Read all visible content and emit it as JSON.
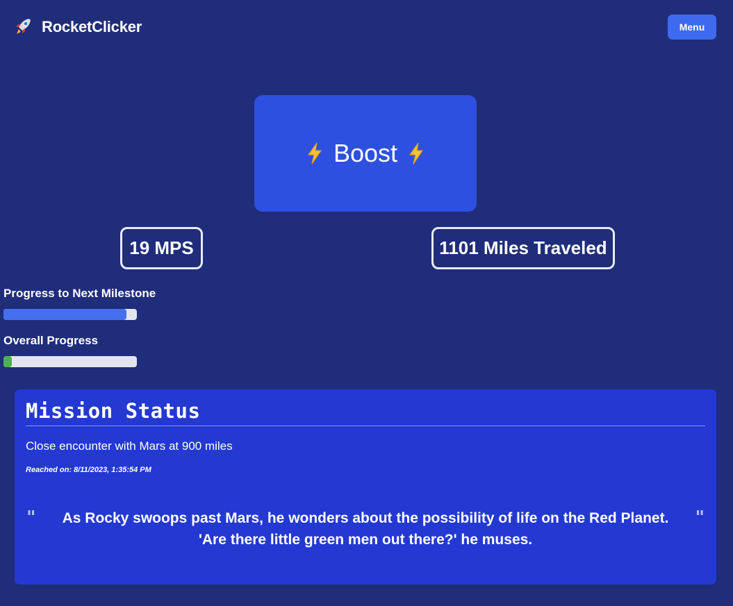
{
  "header": {
    "title": "RocketClicker",
    "logo_icon": "rocket-icon",
    "menu_label": "Menu"
  },
  "boost": {
    "label": "Boost",
    "icon": "lightning-bolt-icon"
  },
  "stats": {
    "mps": "19 MPS",
    "miles": "1101 Miles Traveled"
  },
  "progress": {
    "next_milestone": {
      "label": "Progress to Next Milestone",
      "percent": 92,
      "color": "#4470ee"
    },
    "overall": {
      "label": "Overall Progress",
      "percent": 6,
      "color": "#4cb050"
    }
  },
  "mission": {
    "title": "Mission Status",
    "event": "Close encounter with Mars at 900 miles",
    "reached_on": "Reached on: 8/11/2023, 1:35:54 PM",
    "quote_open": "\"",
    "quote_close": "\"",
    "quote": "As Rocky swoops past Mars, he wonders about the possibility of life on the Red Planet. 'Are there little green men out there?' he muses."
  },
  "colors": {
    "background": "#1f2d7a",
    "accent": "#3e6af0",
    "boost_bg": "#2e50e0",
    "card_bg": "#2339d2"
  }
}
